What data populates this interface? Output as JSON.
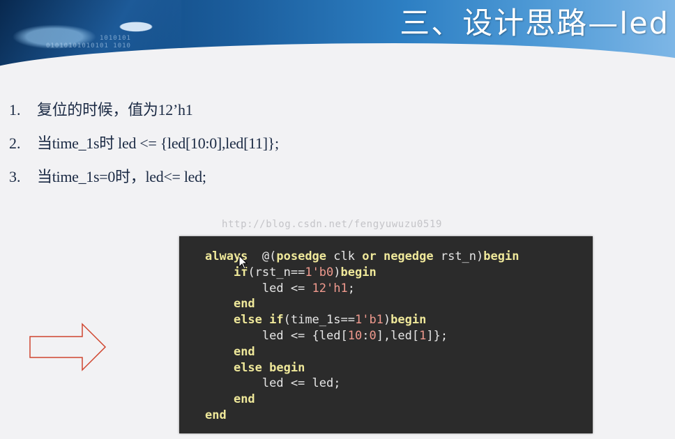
{
  "header": {
    "title": "三、设计思路—led",
    "binary_lines": [
      "1010101",
      "01010101010101 1010"
    ]
  },
  "points": [
    {
      "num": "1.",
      "text": "复位的时候，值为12’h1"
    },
    {
      "num": "2.",
      "text": "当time_1s时  led <= {led[10:0],led[11]};"
    },
    {
      "num": "3.",
      "text": "当time_1s=0时，led<= led;"
    }
  ],
  "watermark": "http://blog.csdn.net/fengyuwuzu0519",
  "code": {
    "lines": [
      [
        {
          "t": "always",
          "c": "kw"
        },
        {
          "t": "  @(",
          "c": "plain"
        },
        {
          "t": "posedge",
          "c": "kw"
        },
        {
          "t": " clk ",
          "c": "plain"
        },
        {
          "t": "or",
          "c": "kw"
        },
        {
          "t": " ",
          "c": "plain"
        },
        {
          "t": "negedge",
          "c": "kw"
        },
        {
          "t": " rst_n)",
          "c": "plain"
        },
        {
          "t": "begin",
          "c": "kw"
        }
      ],
      [
        {
          "t": "    ",
          "c": "plain"
        },
        {
          "t": "if",
          "c": "kw"
        },
        {
          "t": "(rst_n==",
          "c": "plain"
        },
        {
          "t": "1'b0",
          "c": "num-lit"
        },
        {
          "t": ")",
          "c": "plain"
        },
        {
          "t": "begin",
          "c": "kw"
        }
      ],
      [
        {
          "t": "        led <= ",
          "c": "plain"
        },
        {
          "t": "12'h1",
          "c": "num-lit"
        },
        {
          "t": ";",
          "c": "plain"
        }
      ],
      [
        {
          "t": "    ",
          "c": "plain"
        },
        {
          "t": "end",
          "c": "kw"
        }
      ],
      [
        {
          "t": "    ",
          "c": "plain"
        },
        {
          "t": "else if",
          "c": "kw"
        },
        {
          "t": "(time_1s==",
          "c": "plain"
        },
        {
          "t": "1'b1",
          "c": "num-lit"
        },
        {
          "t": ")",
          "c": "plain"
        },
        {
          "t": "begin",
          "c": "kw"
        }
      ],
      [
        {
          "t": "        led <= {led[",
          "c": "plain"
        },
        {
          "t": "10",
          "c": "num-lit"
        },
        {
          "t": ":",
          "c": "plain"
        },
        {
          "t": "0",
          "c": "num-lit"
        },
        {
          "t": "],led[",
          "c": "plain"
        },
        {
          "t": "1",
          "c": "num-lit"
        },
        {
          "t": "]};",
          "c": "plain"
        }
      ],
      [
        {
          "t": "    ",
          "c": "plain"
        },
        {
          "t": "end",
          "c": "kw"
        }
      ],
      [
        {
          "t": "    ",
          "c": "plain"
        },
        {
          "t": "else begin",
          "c": "kw"
        }
      ],
      [
        {
          "t": "        led <= led;",
          "c": "plain"
        }
      ],
      [
        {
          "t": "    ",
          "c": "plain"
        },
        {
          "t": "end",
          "c": "kw"
        }
      ],
      [
        {
          "t": "end",
          "c": "kw"
        }
      ]
    ]
  },
  "colors": {
    "keyword": "#efe89a",
    "number": "#f09a8e",
    "code_bg": "#2b2b2b",
    "arrow_stroke": "#d0452e"
  },
  "icons": {
    "arrow": "right-arrow-outline-icon",
    "cursor": "mouse-pointer-icon"
  }
}
